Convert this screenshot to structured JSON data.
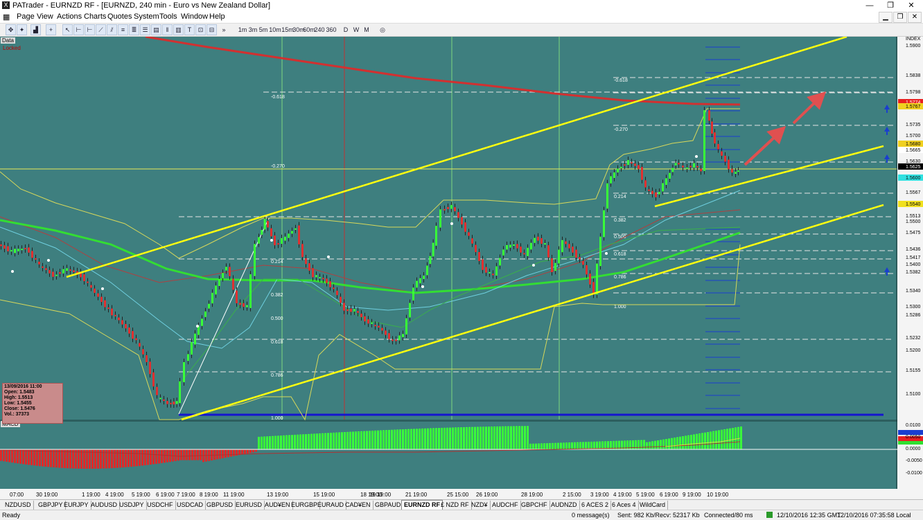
{
  "window": {
    "title": "PATrader - EURNZD RF - [EURNZD, 240 min - Euro vs New Zealand Dollar]"
  },
  "menu": [
    "Page",
    "View",
    "Actions",
    "Charts",
    "Quotes",
    "System",
    "Tools",
    "Window",
    "Help"
  ],
  "toolbar": {
    "timeframes": [
      "1m",
      "3m",
      "5m",
      "10m",
      "15m",
      "30m",
      "60m",
      "240",
      "360",
      "D",
      "W",
      "M"
    ]
  },
  "chart": {
    "panel_label": "Data",
    "locked_label": "Locked",
    "macd_label": "MACD",
    "fib_left": [
      "-0.618",
      "-0.270",
      "0.214",
      "0.382",
      "0.500",
      "0.618",
      "0.786",
      "1.000"
    ],
    "fib_right": [
      "-0.618",
      "-0.270",
      "0.214",
      "0.382",
      "0.500",
      "0.618",
      "0.786",
      "1.000"
    ],
    "price_axis": [
      "INDEX",
      "1.5900",
      "1.5838",
      "1.5798",
      "1.5774",
      "1.5767",
      "1.5735",
      "1.5700",
      "1.5680",
      "1.5665",
      "1.5630",
      "1.5625",
      "1.5600",
      "1.5567",
      "1.5540",
      "1.5513",
      "1.5500",
      "1.5475",
      "1.5436",
      "1.5417",
      "1.5400",
      "1.5382",
      "1.5340",
      "1.5300",
      "1.5286",
      "1.5232",
      "1.5200",
      "1.5155",
      "1.5100"
    ],
    "macd_axis": [
      "0.0100",
      "0.0050",
      "0.0000",
      "-0.0050",
      "-0.0100"
    ],
    "time_axis": [
      "07:00",
      "30 19:00",
      "1 19:00",
      "4 19:00",
      "5 19:00",
      "6 19:00",
      "7 19:00",
      "8 19:00",
      "11 19:00",
      "13 19:00",
      "15 19:00",
      "18 19:00",
      "19 19:00",
      "21 19:00",
      "25 15:00",
      "26 19:00",
      "28 19:00",
      "2 15:00",
      "3 19:00",
      "4 19:00",
      "5 19:00",
      "6 19:00",
      "9 19:00",
      "10 19:00"
    ],
    "infobox": {
      "date": "13/09/2016 11:00",
      "open": "Open: 1.5483",
      "high": "High: 1.5513",
      "low": "Low: 1.5455",
      "close": "Close: 1.5476",
      "vol": "Vol.: 37373"
    }
  },
  "tabs": [
    "NZDUSD",
    "GBPJPY",
    "EURJPY",
    "AUDUSD",
    "USDJPY",
    "USDCHF",
    "USDCAD",
    "GBPUSD",
    "EURUSD",
    "AUD¥EN",
    "EURGBP",
    "EURAUD",
    "CAD¥EN",
    "GBPAUD",
    "EURNZD RF",
    "£ NZD RF",
    "NZD¥",
    "AUDCHF",
    "GBPCHF",
    "AUDNZD",
    "6 ACES 2",
    "6 Aces 4",
    "WildCard"
  ],
  "active_tab": "EURNZD RF",
  "status": {
    "ready": "Ready",
    "messages": "0 message(s)",
    "traffic": "Sent: 982 Kb/Recv: 52317 Kb",
    "connected": "Connected/80 ms",
    "gmt": "12/10/2016 12:35 GMT",
    "local": "12/10/2016 07:35:58 Local"
  },
  "colors": {
    "chart_bg": "#3e7f7f",
    "bull": "#38ff38",
    "bear": "#e03030",
    "trend": "#ffff00",
    "ma_long": "#d02020"
  }
}
